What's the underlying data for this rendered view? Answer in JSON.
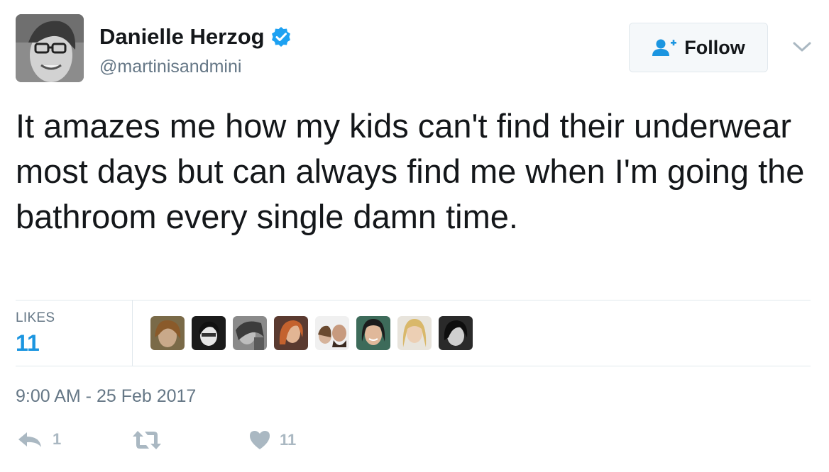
{
  "user": {
    "name": "Danielle Herzog",
    "handle": "@martinisandmini"
  },
  "follow": {
    "label": "Follow"
  },
  "tweet": {
    "text": "It amazes me how my kids can't find their underwear most days but can always find me when I'm going the bathroom every single damn time."
  },
  "stats": {
    "likes_label": "LIKES",
    "likes_count": "11"
  },
  "timestamp": "9:00 AM - 25 Feb 2017",
  "actions": {
    "reply_count": "1",
    "like_count": "11"
  },
  "colors": {
    "accent": "#1b95e0",
    "verified": "#1da1f2",
    "muted": "#657786",
    "icon": "#aab8c2",
    "border": "#e1e8ed"
  },
  "icons": [
    "verified-badge-icon",
    "follow-person-icon",
    "chevron-down-icon",
    "reply-icon",
    "retweet-icon",
    "heart-icon"
  ]
}
